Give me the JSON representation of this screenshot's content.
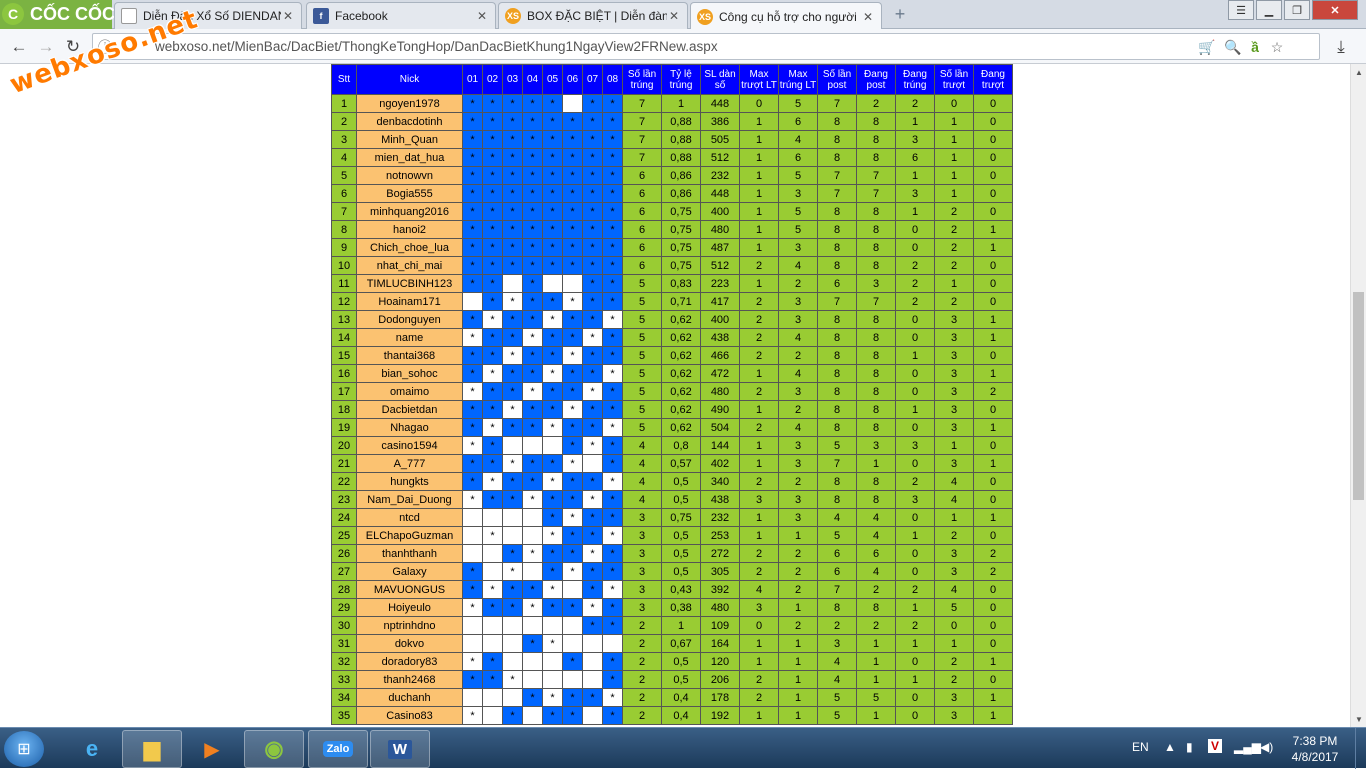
{
  "browser": {
    "logo_text": "CỐC CỐC",
    "tabs": [
      {
        "label": "Diễn Đàn Xổ Số DIENDAN",
        "icon": "page-icon"
      },
      {
        "label": "Facebook",
        "icon": "facebook-icon"
      },
      {
        "label": "BOX ĐẶC BIỆT | Diễn đàn",
        "icon": "xs-icon",
        "icon_text": "XS"
      },
      {
        "label": "Công cụ hỗ trợ cho người",
        "icon": "xs-icon",
        "icon_text": "XS"
      }
    ],
    "url": "webxoso.net/MienBac/DacBiet/ThongKeTongHop/DanDacBietKhung1NgayView2FRNew.aspx",
    "watermark": "webxoso.net"
  },
  "table": {
    "headers": [
      "Stt",
      "Nick",
      "01",
      "02",
      "03",
      "04",
      "05",
      "06",
      "07",
      "08",
      "Số lần trúng",
      "Tỷ lệ trúng",
      "SL dàn số",
      "Max trượt LT",
      "Max trúng LT",
      "Số lần post",
      "Đang post",
      "Đang trúng",
      "Số lần trượt",
      "Đang trượt"
    ],
    "rows": [
      {
        "stt": "1",
        "nick": "ngoyen1978",
        "d": "*****_**",
        "s": [
          "7",
          "1",
          "448",
          "0",
          "5",
          "7",
          "2",
          "2",
          "0",
          "0"
        ]
      },
      {
        "stt": "2",
        "nick": "denbacdotinh",
        "d": "********",
        "s": [
          "7",
          "0,88",
          "386",
          "1",
          "6",
          "8",
          "8",
          "1",
          "1",
          "0"
        ]
      },
      {
        "stt": "3",
        "nick": "Minh_Quan",
        "d": "********",
        "s": [
          "7",
          "0,88",
          "505",
          "1",
          "4",
          "8",
          "8",
          "3",
          "1",
          "0"
        ]
      },
      {
        "stt": "4",
        "nick": "mien_dat_hua",
        "d": "********",
        "s": [
          "7",
          "0,88",
          "512",
          "1",
          "6",
          "8",
          "8",
          "6",
          "1",
          "0"
        ]
      },
      {
        "stt": "5",
        "nick": "notnowvn",
        "d": "********",
        "s": [
          "6",
          "0,86",
          "232",
          "1",
          "5",
          "7",
          "7",
          "1",
          "1",
          "0"
        ]
      },
      {
        "stt": "6",
        "nick": "Bogia555",
        "d": "********",
        "s": [
          "6",
          "0,86",
          "448",
          "1",
          "3",
          "7",
          "7",
          "3",
          "1",
          "0"
        ]
      },
      {
        "stt": "7",
        "nick": "minhquang2016",
        "d": "********",
        "s": [
          "6",
          "0,75",
          "400",
          "1",
          "5",
          "8",
          "8",
          "1",
          "2",
          "0"
        ]
      },
      {
        "stt": "8",
        "nick": "hanoi2",
        "d": "********",
        "s": [
          "6",
          "0,75",
          "480",
          "1",
          "5",
          "8",
          "8",
          "0",
          "2",
          "1"
        ]
      },
      {
        "stt": "9",
        "nick": "Chich_choe_lua",
        "d": "********",
        "s": [
          "6",
          "0,75",
          "487",
          "1",
          "3",
          "8",
          "8",
          "0",
          "2",
          "1"
        ]
      },
      {
        "stt": "10",
        "nick": "nhat_chi_mai",
        "d": "********",
        "s": [
          "6",
          "0,75",
          "512",
          "2",
          "4",
          "8",
          "8",
          "2",
          "2",
          "0"
        ]
      },
      {
        "stt": "11",
        "nick": "TIMLUCBINH123",
        "d": "**_*__**",
        "s": [
          "5",
          "0,83",
          "223",
          "1",
          "2",
          "6",
          "3",
          "2",
          "1",
          "0"
        ]
      },
      {
        "stt": "12",
        "nick": "Hoainam171",
        "d": "_*******",
        "s": [
          "5",
          "0,71",
          "417",
          "2",
          "3",
          "7",
          "7",
          "2",
          "2",
          "0"
        ]
      },
      {
        "stt": "13",
        "nick": "Dodonguyen",
        "d": "********",
        "s": [
          "5",
          "0,62",
          "400",
          "2",
          "3",
          "8",
          "8",
          "0",
          "3",
          "1"
        ]
      },
      {
        "stt": "14",
        "nick": "name",
        "d": "********",
        "s": [
          "5",
          "0,62",
          "438",
          "2",
          "4",
          "8",
          "8",
          "0",
          "3",
          "1"
        ]
      },
      {
        "stt": "15",
        "nick": "thantai368",
        "d": "********",
        "s": [
          "5",
          "0,62",
          "466",
          "2",
          "2",
          "8",
          "8",
          "1",
          "3",
          "0"
        ]
      },
      {
        "stt": "16",
        "nick": "bian_sohoc",
        "d": "********",
        "s": [
          "5",
          "0,62",
          "472",
          "1",
          "4",
          "8",
          "8",
          "0",
          "3",
          "1"
        ]
      },
      {
        "stt": "17",
        "nick": "omaimo",
        "d": "********",
        "s": [
          "5",
          "0,62",
          "480",
          "2",
          "3",
          "8",
          "8",
          "0",
          "3",
          "2"
        ]
      },
      {
        "stt": "18",
        "nick": "Dacbietdan",
        "d": "********",
        "s": [
          "5",
          "0,62",
          "490",
          "1",
          "2",
          "8",
          "8",
          "1",
          "3",
          "0"
        ]
      },
      {
        "stt": "19",
        "nick": "Nhagao",
        "d": "********",
        "s": [
          "5",
          "0,62",
          "504",
          "2",
          "4",
          "8",
          "8",
          "0",
          "3",
          "1"
        ]
      },
      {
        "stt": "20",
        "nick": "casino1594",
        "d": "**___***",
        "s": [
          "4",
          "0,8",
          "144",
          "1",
          "3",
          "5",
          "3",
          "3",
          "1",
          "0"
        ]
      },
      {
        "stt": "21",
        "nick": "A_777",
        "d": "******_*",
        "s": [
          "4",
          "0,57",
          "402",
          "1",
          "3",
          "7",
          "1",
          "0",
          "3",
          "1"
        ]
      },
      {
        "stt": "22",
        "nick": "hungkts",
        "d": "********",
        "s": [
          "4",
          "0,5",
          "340",
          "2",
          "2",
          "8",
          "8",
          "2",
          "4",
          "0"
        ]
      },
      {
        "stt": "23",
        "nick": "Nam_Dai_Duong",
        "d": "********",
        "s": [
          "4",
          "0,5",
          "438",
          "3",
          "3",
          "8",
          "8",
          "3",
          "4",
          "0"
        ]
      },
      {
        "stt": "24",
        "nick": "ntcd",
        "d": "____****",
        "s": [
          "3",
          "0,75",
          "232",
          "1",
          "3",
          "4",
          "4",
          "0",
          "1",
          "1"
        ]
      },
      {
        "stt": "25",
        "nick": "ELChapoGuzman",
        "d": "_*__****",
        "s": [
          "3",
          "0,5",
          "253",
          "1",
          "1",
          "5",
          "4",
          "1",
          "2",
          "0"
        ]
      },
      {
        "stt": "26",
        "nick": "thanhthanh",
        "d": "__******",
        "s": [
          "3",
          "0,5",
          "272",
          "2",
          "2",
          "6",
          "6",
          "0",
          "3",
          "2"
        ]
      },
      {
        "stt": "27",
        "nick": "Galaxy",
        "d": "*_*_****",
        "s": [
          "3",
          "0,5",
          "305",
          "2",
          "2",
          "6",
          "4",
          "0",
          "3",
          "2"
        ]
      },
      {
        "stt": "28",
        "nick": "MAVUONGUS",
        "d": "*****_**",
        "s": [
          "3",
          "0,43",
          "392",
          "4",
          "2",
          "7",
          "2",
          "2",
          "4",
          "0"
        ]
      },
      {
        "stt": "29",
        "nick": "Hoiyeulo",
        "d": "********",
        "s": [
          "3",
          "0,38",
          "480",
          "3",
          "1",
          "8",
          "8",
          "1",
          "5",
          "0"
        ]
      },
      {
        "stt": "30",
        "nick": "nptrinhdno",
        "d": "______**",
        "s": [
          "2",
          "1",
          "109",
          "0",
          "2",
          "2",
          "2",
          "2",
          "0",
          "0"
        ]
      },
      {
        "stt": "31",
        "nick": "dokvo",
        "d": "___**___",
        "s": [
          "2",
          "0,67",
          "164",
          "1",
          "1",
          "3",
          "1",
          "1",
          "1",
          "0"
        ]
      },
      {
        "stt": "32",
        "nick": "doradory83",
        "d": "**___*_*",
        "s": [
          "2",
          "0,5",
          "120",
          "1",
          "1",
          "4",
          "1",
          "0",
          "2",
          "1"
        ]
      },
      {
        "stt": "33",
        "nick": "thanh2468",
        "d": "***____*",
        "s": [
          "2",
          "0,5",
          "206",
          "2",
          "1",
          "4",
          "1",
          "1",
          "2",
          "0"
        ]
      },
      {
        "stt": "34",
        "nick": "duchanh",
        "d": "___*****",
        "s": [
          "2",
          "0,4",
          "178",
          "2",
          "1",
          "5",
          "5",
          "0",
          "3",
          "1"
        ]
      },
      {
        "stt": "35",
        "nick": "Casino83",
        "d": "*_*_**_*",
        "s": [
          "2",
          "0,4",
          "192",
          "1",
          "1",
          "5",
          "1",
          "0",
          "3",
          "1"
        ]
      }
    ]
  },
  "taskbar": {
    "lang": "EN",
    "time": "7:38 PM",
    "date": "4/8/2017"
  }
}
